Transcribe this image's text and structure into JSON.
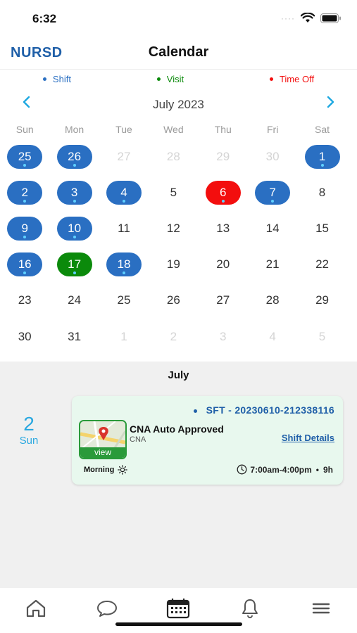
{
  "status_bar": {
    "time": "6:32"
  },
  "header": {
    "logo": "NURSD",
    "title": "Calendar"
  },
  "legend": [
    {
      "label": "Shift",
      "color": "#2a6fc2"
    },
    {
      "label": "Visit",
      "color": "#0b8a0b"
    },
    {
      "label": "Time Off",
      "color": "#f30e0e"
    }
  ],
  "calendar": {
    "month_label": "July 2023",
    "prev_icon": "chevron-left-icon",
    "next_icon": "chevron-right-icon",
    "weekdays": [
      "Sun",
      "Mon",
      "Tue",
      "Wed",
      "Thu",
      "Fri",
      "Sat"
    ],
    "days": [
      {
        "d": "25",
        "state": "shift",
        "other": true,
        "marker": true
      },
      {
        "d": "26",
        "state": "shift",
        "other": true,
        "marker": true
      },
      {
        "d": "27",
        "state": "none",
        "other": true
      },
      {
        "d": "28",
        "state": "none",
        "other": true
      },
      {
        "d": "29",
        "state": "none",
        "other": true
      },
      {
        "d": "30",
        "state": "none",
        "other": true
      },
      {
        "d": "1",
        "state": "shift",
        "marker": true
      },
      {
        "d": "2",
        "state": "shift",
        "marker": true
      },
      {
        "d": "3",
        "state": "shift",
        "marker": true
      },
      {
        "d": "4",
        "state": "shift",
        "marker": true
      },
      {
        "d": "5",
        "state": "none"
      },
      {
        "d": "6",
        "state": "timeoff",
        "marker": true
      },
      {
        "d": "7",
        "state": "shift",
        "marker": true
      },
      {
        "d": "8",
        "state": "none"
      },
      {
        "d": "9",
        "state": "shift",
        "marker": true
      },
      {
        "d": "10",
        "state": "shift",
        "marker": true
      },
      {
        "d": "11",
        "state": "none"
      },
      {
        "d": "12",
        "state": "none"
      },
      {
        "d": "13",
        "state": "none"
      },
      {
        "d": "14",
        "state": "none"
      },
      {
        "d": "15",
        "state": "none"
      },
      {
        "d": "16",
        "state": "shift",
        "marker": true
      },
      {
        "d": "17",
        "state": "visit",
        "marker": true
      },
      {
        "d": "18",
        "state": "shift",
        "marker": true
      },
      {
        "d": "19",
        "state": "none"
      },
      {
        "d": "20",
        "state": "none"
      },
      {
        "d": "21",
        "state": "none"
      },
      {
        "d": "22",
        "state": "none"
      },
      {
        "d": "23",
        "state": "none"
      },
      {
        "d": "24",
        "state": "none"
      },
      {
        "d": "25",
        "state": "none"
      },
      {
        "d": "26",
        "state": "none"
      },
      {
        "d": "27",
        "state": "none"
      },
      {
        "d": "28",
        "state": "none"
      },
      {
        "d": "29",
        "state": "none"
      },
      {
        "d": "30",
        "state": "none"
      },
      {
        "d": "31",
        "state": "none"
      },
      {
        "d": "1",
        "state": "none",
        "other": true
      },
      {
        "d": "2",
        "state": "none",
        "other": true
      },
      {
        "d": "3",
        "state": "none",
        "other": true
      },
      {
        "d": "4",
        "state": "none",
        "other": true
      },
      {
        "d": "5",
        "state": "none",
        "other": true
      }
    ]
  },
  "schedule": {
    "month": "July",
    "date_number": "2",
    "date_weekday": "Sun",
    "card": {
      "code": "SFT - 20230610-212338116",
      "title": "CNA Auto Approved",
      "role": "CNA",
      "thumb_label": "view",
      "details_link": "Shift Details",
      "period": "Morning",
      "period_icon": "sun-icon",
      "hours": "7:00am-4:00pm",
      "separator": "•",
      "duration": "9h"
    }
  },
  "tabbar": [
    {
      "name": "home",
      "icon": "home-icon"
    },
    {
      "name": "messages",
      "icon": "chat-bubble-icon"
    },
    {
      "name": "calendar",
      "icon": "calendar-icon",
      "active": true
    },
    {
      "name": "notifications",
      "icon": "bell-icon"
    },
    {
      "name": "menu",
      "icon": "menu-icon"
    }
  ]
}
